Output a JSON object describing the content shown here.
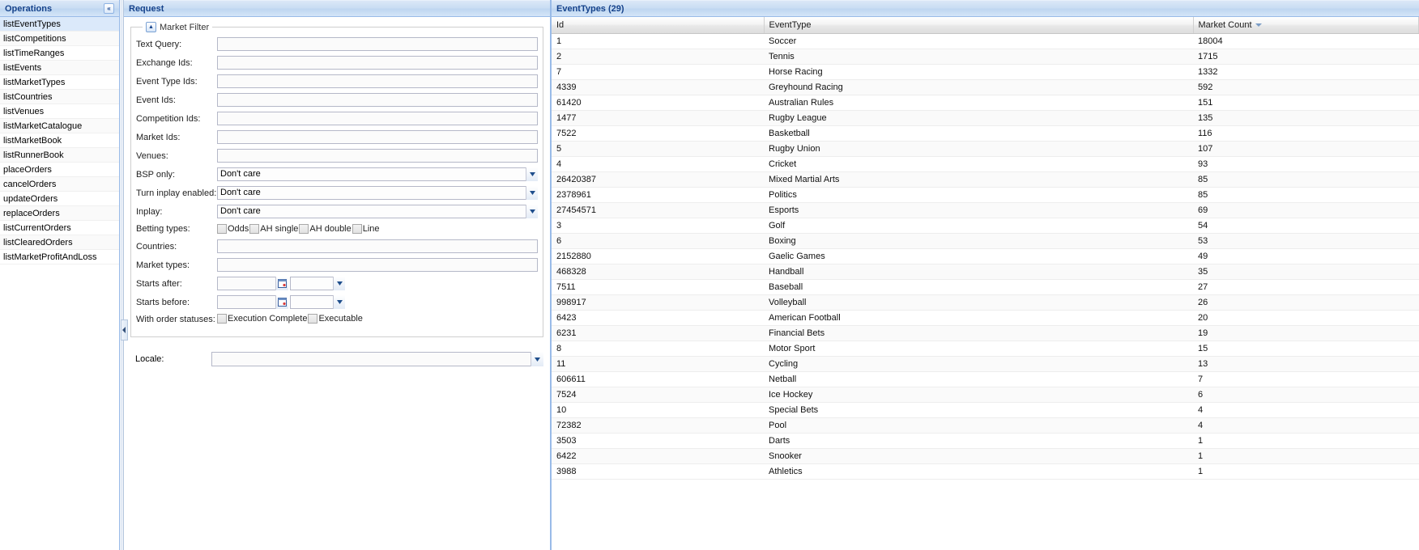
{
  "sidebar": {
    "title": "Operations",
    "collapse_icon": "«",
    "items": [
      {
        "label": "listEventTypes",
        "selected": true
      },
      {
        "label": "listCompetitions",
        "selected": false
      },
      {
        "label": "listTimeRanges",
        "selected": false
      },
      {
        "label": "listEvents",
        "selected": false
      },
      {
        "label": "listMarketTypes",
        "selected": false
      },
      {
        "label": "listCountries",
        "selected": false
      },
      {
        "label": "listVenues",
        "selected": false
      },
      {
        "label": "listMarketCatalogue",
        "selected": false
      },
      {
        "label": "listMarketBook",
        "selected": false
      },
      {
        "label": "listRunnerBook",
        "selected": false
      },
      {
        "label": "placeOrders",
        "selected": false
      },
      {
        "label": "cancelOrders",
        "selected": false
      },
      {
        "label": "updateOrders",
        "selected": false
      },
      {
        "label": "replaceOrders",
        "selected": false
      },
      {
        "label": "listCurrentOrders",
        "selected": false
      },
      {
        "label": "listClearedOrders",
        "selected": false
      },
      {
        "label": "listMarketProfitAndLoss",
        "selected": false
      }
    ]
  },
  "request": {
    "title": "Request",
    "market_filter": {
      "legend": "Market Filter",
      "toggle_icon": "▲"
    },
    "fields": {
      "text_query": {
        "label": "Text Query:",
        "value": "",
        "placeholder": ""
      },
      "exchange_ids": {
        "label": "Exchange Ids:",
        "value": "",
        "placeholder": ""
      },
      "event_type_ids": {
        "label": "Event Type Ids:",
        "value": "",
        "placeholder": ""
      },
      "event_ids": {
        "label": "Event Ids:",
        "value": "",
        "placeholder": ""
      },
      "competition_ids": {
        "label": "Competition Ids:",
        "value": "",
        "placeholder": ""
      },
      "market_ids": {
        "label": "Market Ids:",
        "value": "",
        "placeholder": ""
      },
      "venues": {
        "label": "Venues:",
        "value": "",
        "placeholder": ""
      },
      "bsp_only": {
        "label": "BSP only:",
        "value": "Don't care"
      },
      "turn_inplay_enabled": {
        "label": "Turn inplay enabled:",
        "value": "Don't care"
      },
      "inplay": {
        "label": "Inplay:",
        "value": "Don't care"
      },
      "betting_types": {
        "label": "Betting types:",
        "options": [
          {
            "label": "Odds",
            "checked": false
          },
          {
            "label": "AH single",
            "checked": false
          },
          {
            "label": "AH double",
            "checked": false
          },
          {
            "label": "Line",
            "checked": false
          }
        ]
      },
      "countries": {
        "label": "Countries:",
        "value": "",
        "placeholder": ""
      },
      "market_types": {
        "label": "Market types:",
        "value": "",
        "placeholder": ""
      },
      "starts_after": {
        "label": "Starts after:",
        "value": "",
        "timezone": ""
      },
      "starts_before": {
        "label": "Starts before:",
        "value": "",
        "timezone": ""
      },
      "with_order_statuses": {
        "label": "With order statuses:",
        "options": [
          {
            "label": "Execution Complete",
            "checked": false
          },
          {
            "label": "Executable",
            "checked": false
          }
        ]
      },
      "locale": {
        "label": "Locale:",
        "value": ""
      }
    }
  },
  "grid": {
    "title": "EventTypes (29)",
    "columns": [
      {
        "key": "id",
        "label": "Id",
        "sorted": false
      },
      {
        "key": "event_type",
        "label": "EventType",
        "sorted": false
      },
      {
        "key": "market_count",
        "label": "Market Count",
        "sorted": true,
        "sort_dir": "desc"
      }
    ],
    "rows": [
      {
        "id": "1",
        "event_type": "Soccer",
        "market_count": "18004"
      },
      {
        "id": "2",
        "event_type": "Tennis",
        "market_count": "1715"
      },
      {
        "id": "7",
        "event_type": "Horse Racing",
        "market_count": "1332"
      },
      {
        "id": "4339",
        "event_type": "Greyhound Racing",
        "market_count": "592"
      },
      {
        "id": "61420",
        "event_type": "Australian Rules",
        "market_count": "151"
      },
      {
        "id": "1477",
        "event_type": "Rugby League",
        "market_count": "135"
      },
      {
        "id": "7522",
        "event_type": "Basketball",
        "market_count": "116"
      },
      {
        "id": "5",
        "event_type": "Rugby Union",
        "market_count": "107"
      },
      {
        "id": "4",
        "event_type": "Cricket",
        "market_count": "93"
      },
      {
        "id": "26420387",
        "event_type": "Mixed Martial Arts",
        "market_count": "85"
      },
      {
        "id": "2378961",
        "event_type": "Politics",
        "market_count": "85"
      },
      {
        "id": "27454571",
        "event_type": "Esports",
        "market_count": "69"
      },
      {
        "id": "3",
        "event_type": "Golf",
        "market_count": "54"
      },
      {
        "id": "6",
        "event_type": "Boxing",
        "market_count": "53"
      },
      {
        "id": "2152880",
        "event_type": "Gaelic Games",
        "market_count": "49"
      },
      {
        "id": "468328",
        "event_type": "Handball",
        "market_count": "35"
      },
      {
        "id": "7511",
        "event_type": "Baseball",
        "market_count": "27"
      },
      {
        "id": "998917",
        "event_type": "Volleyball",
        "market_count": "26"
      },
      {
        "id": "6423",
        "event_type": "American Football",
        "market_count": "20"
      },
      {
        "id": "6231",
        "event_type": "Financial Bets",
        "market_count": "19"
      },
      {
        "id": "8",
        "event_type": "Motor Sport",
        "market_count": "15"
      },
      {
        "id": "11",
        "event_type": "Cycling",
        "market_count": "13"
      },
      {
        "id": "606611",
        "event_type": "Netball",
        "market_count": "7"
      },
      {
        "id": "7524",
        "event_type": "Ice Hockey",
        "market_count": "6"
      },
      {
        "id": "10",
        "event_type": "Special Bets",
        "market_count": "4"
      },
      {
        "id": "72382",
        "event_type": "Pool",
        "market_count": "4"
      },
      {
        "id": "3503",
        "event_type": "Darts",
        "market_count": "1"
      },
      {
        "id": "6422",
        "event_type": "Snooker",
        "market_count": "1"
      },
      {
        "id": "3988",
        "event_type": "Athletics",
        "market_count": "1"
      }
    ]
  },
  "colors": {
    "header_text": "#15428b",
    "header_border": "#99bbe8",
    "selection": "#dbe9fa"
  }
}
